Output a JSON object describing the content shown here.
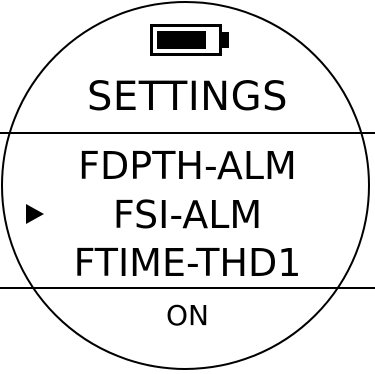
{
  "status": {
    "battery_icon": "battery-icon",
    "battery_level": 0.85
  },
  "header": {
    "title": "SETTINGS"
  },
  "menu": {
    "items": [
      {
        "label": "FDPTH-ALM",
        "selected": false
      },
      {
        "label": "FSI-ALM",
        "selected": true
      },
      {
        "label": "FTIME-THD1",
        "selected": false
      }
    ],
    "pointer_icon": "triangle-right-icon"
  },
  "footer": {
    "value": "ON"
  }
}
